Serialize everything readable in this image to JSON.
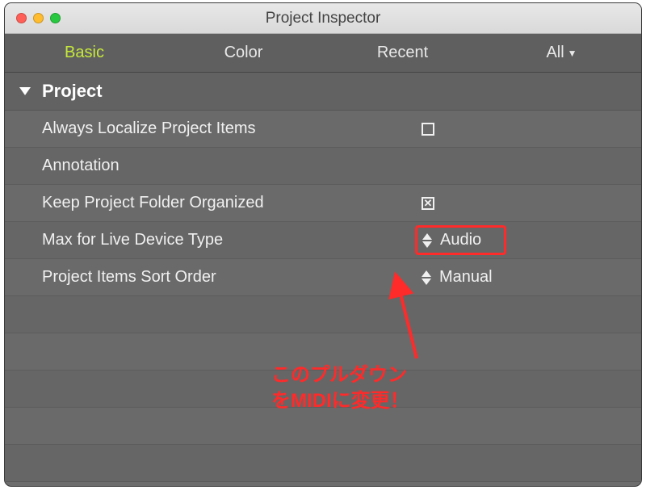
{
  "window": {
    "title": "Project Inspector"
  },
  "tabs": {
    "basic": "Basic",
    "color": "Color",
    "recent": "Recent",
    "all": "All"
  },
  "section": {
    "title": "Project"
  },
  "rows": {
    "localize": {
      "label": "Always Localize Project Items",
      "checked": false
    },
    "annotation": {
      "label": "Annotation"
    },
    "keep_organized": {
      "label": "Keep Project Folder Organized",
      "checked": true
    },
    "device_type": {
      "label": "Max for Live Device Type",
      "value": "Audio"
    },
    "sort_order": {
      "label": "Project Items Sort Order",
      "value": "Manual"
    }
  },
  "callout": {
    "line1": "このプルダウン",
    "line2": "をMIDIに変更！"
  },
  "colors": {
    "accent": "#ff2a2a",
    "active_tab": "#c6e83b"
  }
}
